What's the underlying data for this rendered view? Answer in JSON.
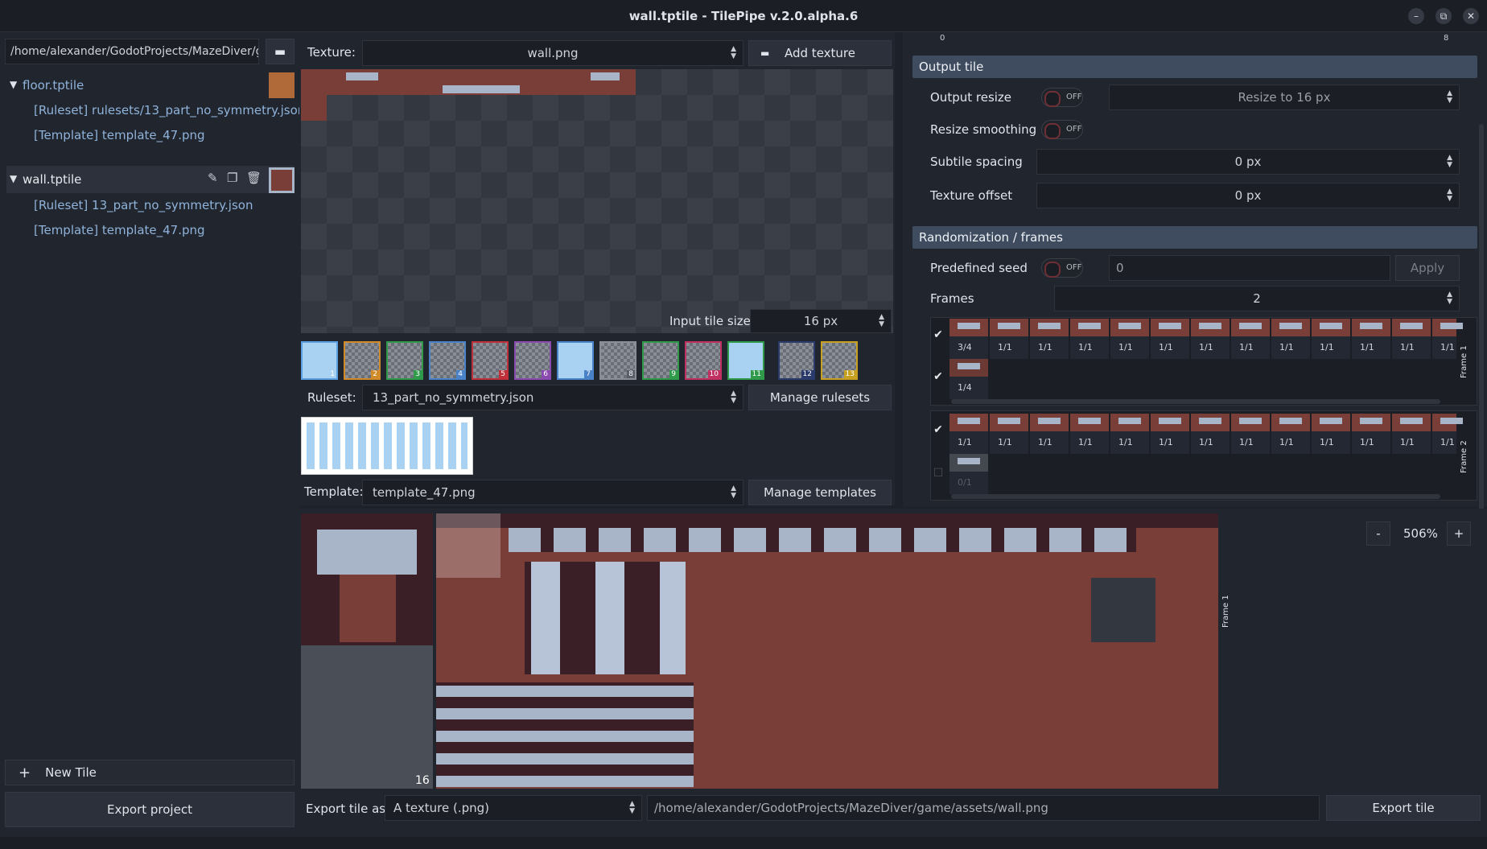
{
  "window": {
    "title": "wall.tptile - TilePipe v.2.0.alpha.6",
    "minimize": "–",
    "maximize": "⧉",
    "close": "✕"
  },
  "sidebar": {
    "path": "/home/alexander/GodotProjects/MazeDiver/g",
    "tiles": [
      {
        "name": "floor.tptile",
        "ruleset": "[Ruleset] rulesets/13_part_no_symmetry.json",
        "template": "[Template] template_47.png"
      },
      {
        "name": "wall.tptile",
        "ruleset": "[Ruleset] 13_part_no_symmetry.json",
        "template": "[Template] template_47.png"
      }
    ],
    "new_tile": "New Tile",
    "new_tile_icon": "+",
    "export_project": "Export project"
  },
  "texture": {
    "label": "Texture:",
    "value": "wall.png",
    "add": "Add texture",
    "input_tile_size_label": "Input tile size:",
    "input_tile_size": "16 px"
  },
  "ruleset": {
    "label": "Ruleset:",
    "value": "13_part_no_symmetry.json",
    "manage": "Manage rulesets",
    "parts": [
      "1",
      "2",
      "3",
      "4",
      "5",
      "6",
      "7",
      "8",
      "9",
      "10",
      "11",
      "12",
      "13"
    ]
  },
  "template": {
    "label": "Template:",
    "value": "template_47.png",
    "manage": "Manage templates"
  },
  "settings": {
    "ruler_left": "0",
    "ruler_right": "8",
    "output_tile": "Output tile",
    "output_resize": "Output resize",
    "output_resize_state": "OFF",
    "resize_to": "Resize to  16  px",
    "resize_smoothing": "Resize smoothing",
    "resize_smoothing_state": "OFF",
    "subtile_spacing": "Subtile spacing",
    "subtile_spacing_value": "0 px",
    "texture_offset": "Texture offset",
    "texture_offset_value": "0 px",
    "randomization": "Randomization / frames",
    "predefined_seed": "Predefined seed",
    "seed_state": "OFF",
    "seed_value": "0",
    "apply": "Apply",
    "frames_label": "Frames",
    "frames_value": "2",
    "frame1_label": "Frame 1",
    "frame2_label": "Frame 2",
    "frame1_row1": [
      "3/4",
      "1/1",
      "1/1",
      "1/1",
      "1/1",
      "1/1",
      "1/1",
      "1/1",
      "1/1",
      "1/1",
      "1/1",
      "1/1",
      "1/1"
    ],
    "frame1_row2": [
      "1/4"
    ],
    "frame2_row1": [
      "1/1",
      "1/1",
      "1/1",
      "1/1",
      "1/1",
      "1/1",
      "1/1",
      "1/1",
      "1/1",
      "1/1",
      "1/1",
      "1/1",
      "1/1"
    ],
    "frame2_row2": [
      "0/1"
    ]
  },
  "preview": {
    "zoom_minus": "-",
    "zoom": "506%",
    "zoom_plus": "+",
    "tile_size": "16",
    "frame_label": "Frame 1"
  },
  "export": {
    "label": "Export tile as:",
    "type": "A texture (.png)",
    "path": "/home/alexander/GodotProjects/MazeDiver/game/assets/wall.png",
    "button": "Export tile"
  },
  "colors": {
    "accent": "#3f4c60",
    "wall_brick": "#7a3e38",
    "checker_a": "#33373f",
    "checker_b": "#3b3f47"
  }
}
